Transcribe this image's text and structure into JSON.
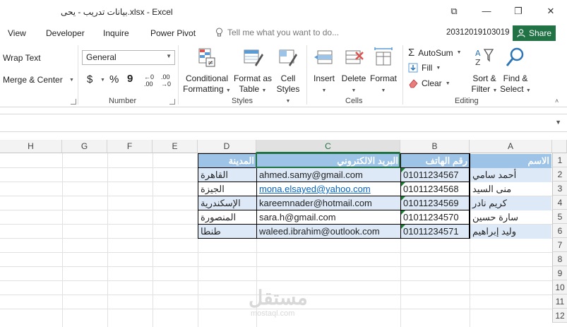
{
  "window": {
    "title": "بيانات تدريب - يحى.xlsx - Excel",
    "controls": [
      "⧉",
      "—",
      "❐",
      "✕"
    ]
  },
  "menu": {
    "tabs": [
      "View",
      "Developer",
      "Inquire",
      "Power Pivot"
    ],
    "tell_me": "Tell me what you want to do...",
    "account": "20312019103019",
    "share": "Share"
  },
  "ribbon": {
    "alignment": {
      "wrap_text": "Wrap Text",
      "merge_center": "Merge & Center"
    },
    "number": {
      "format_value": "General",
      "currency": "$",
      "percent": "%",
      "comma": "9",
      "inc_decimal": "←0 .00",
      "dec_decimal": ".00 →0",
      "label": "Number"
    },
    "styles": {
      "conditional": "Conditional",
      "conditional2": "Formatting",
      "format_as": "Format as",
      "table": "Table",
      "cell": "Cell",
      "styles": "Styles",
      "label": "Styles"
    },
    "cells": {
      "insert": "Insert",
      "delete": "Delete",
      "format": "Format",
      "label": "Cells"
    },
    "editing": {
      "autosum": "AutoSum",
      "fill": "Fill",
      "clear": "Clear",
      "sort": "Sort &",
      "filter": "Filter",
      "find": "Find &",
      "select": "Select",
      "label": "Editing"
    }
  },
  "sheet": {
    "columns": [
      "H",
      "G",
      "F",
      "E",
      "D",
      "C",
      "B",
      "A"
    ],
    "rows": [
      "1",
      "2",
      "3",
      "4",
      "5",
      "6",
      "7",
      "8",
      "9",
      "10",
      "11",
      "12"
    ],
    "headers": {
      "name": "الاسم",
      "phone": "رقم الهاتف",
      "email": "البريد الالكتروني",
      "city": "المدينة"
    },
    "records": [
      {
        "name": "أحمد سامي",
        "phone": "01011234567",
        "email": "ahmed.samy@gmail.com",
        "city": "القاهرة"
      },
      {
        "name": "منى السيد",
        "phone": "01011234568",
        "email": "mona.elsayed@yahoo.com",
        "city": "الجيزة"
      },
      {
        "name": "كريم نادر",
        "phone": "01011234569",
        "email": "kareemnader@hotmail.com",
        "city": "الإسكندرية"
      },
      {
        "name": "سارة حسين",
        "phone": "01011234570",
        "email": "sara.h@gmail.com",
        "city": "المنصورة"
      },
      {
        "name": "وليد إبراهيم",
        "phone": "01011234571",
        "email": "waleed.ibrahim@outlook.com",
        "city": "طنطا"
      }
    ]
  },
  "watermark": {
    "text": "مستقل",
    "sub": "mostaql.com"
  },
  "colors": {
    "excel_green": "#217346",
    "header_blue": "#9dc3e6",
    "band_blue": "#dde9f7",
    "link": "#0563c1"
  }
}
